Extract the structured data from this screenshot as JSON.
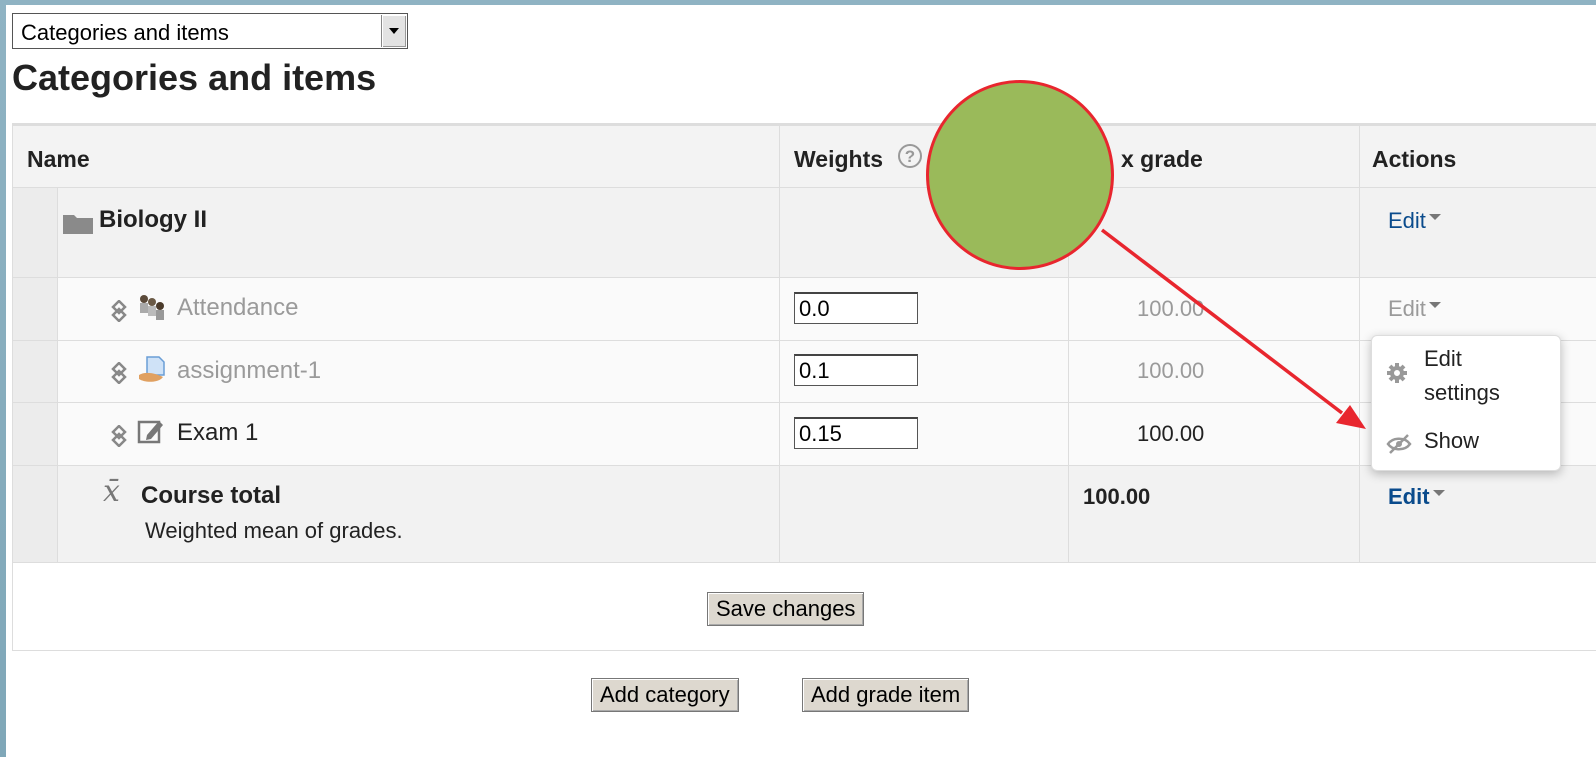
{
  "view_select": {
    "value": "Categories and items"
  },
  "page_title": "Categories and items",
  "table": {
    "headers": {
      "name": "Name",
      "weights": "Weights",
      "max_grade": "x grade",
      "actions": "Actions"
    },
    "category": {
      "name": "Biology II",
      "action": "Edit"
    },
    "items": [
      {
        "name": "Attendance",
        "weight": "0.0",
        "max_grade": "100.00",
        "action": "Edit",
        "hidden": true,
        "icon": "attendance-icon"
      },
      {
        "name": "assignment-1",
        "weight": "0.1",
        "max_grade": "100.00",
        "hidden": true,
        "icon": "assignment-icon"
      },
      {
        "name": "Exam 1",
        "weight": "0.15",
        "max_grade": "100.00",
        "hidden": false,
        "icon": "quiz-icon"
      }
    ],
    "course_total": {
      "name": "Course total",
      "description": "Weighted mean of grades.",
      "max_grade": "100.00",
      "action": "Edit"
    }
  },
  "buttons": {
    "save": "Save changes",
    "add_category": "Add category",
    "add_grade_item": "Add grade item"
  },
  "dropdown_menu": {
    "items": [
      {
        "label_line1": "Edit",
        "label_line2": "settings",
        "icon": "gear-icon"
      },
      {
        "label": "Show",
        "icon": "eye-slash-icon"
      }
    ]
  },
  "colors": {
    "link": "#0a4b8c",
    "annotation_fill": "#9aba5a",
    "annotation_stroke": "#e8262e",
    "muted_text": "#9a9a9a"
  }
}
